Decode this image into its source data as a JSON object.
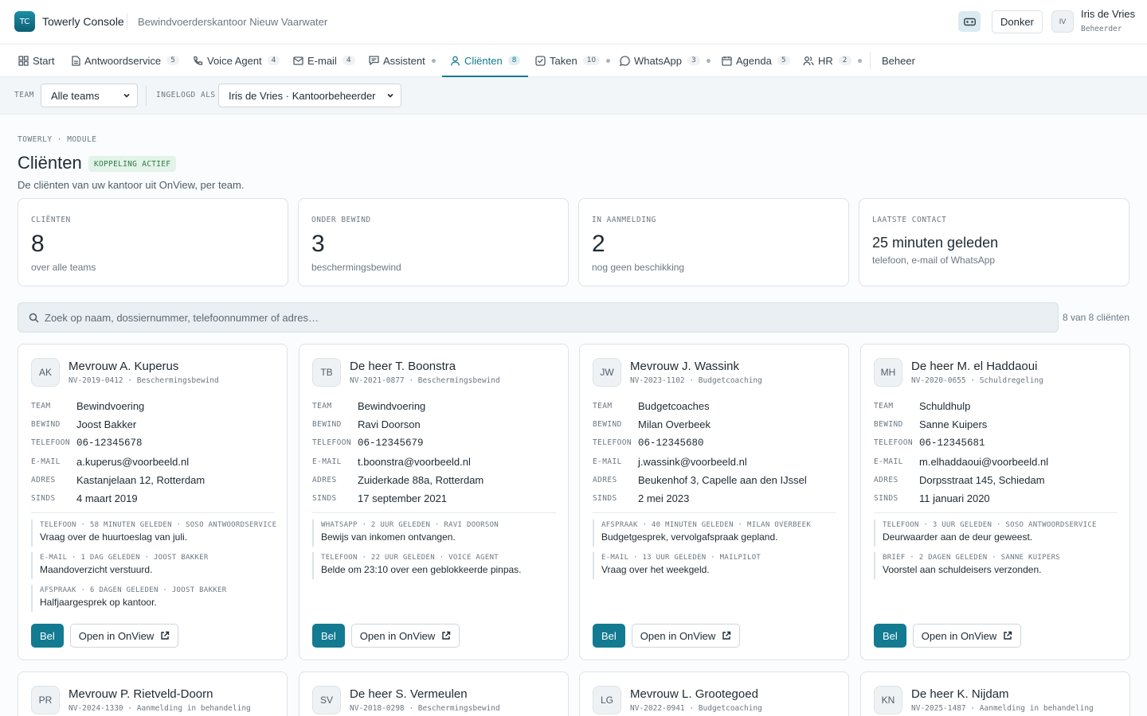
{
  "app": {
    "logo_initials": "TC",
    "name": "Towerly Console",
    "organization": "Bewindvoerderskantoor Nieuw Vaarwater",
    "theme_button": "Donker",
    "user": {
      "initials": "IV",
      "name": "Iris de Vries",
      "role": "Beheerder"
    }
  },
  "nav": [
    {
      "label": "Start",
      "icon": "grid-icon"
    },
    {
      "label": "Antwoordservice",
      "badge": "5",
      "icon": "document-icon"
    },
    {
      "label": "Voice Agent",
      "badge": "4",
      "icon": "phone-icon"
    },
    {
      "label": "E-mail",
      "badge": "4",
      "icon": "mail-icon"
    },
    {
      "label": "Assistent",
      "dot": true,
      "icon": "chat-icon"
    },
    {
      "label": "Cliënten",
      "badge": "8",
      "icon": "user-icon",
      "active": true
    },
    {
      "label": "Taken",
      "badge": "10",
      "dot": true,
      "icon": "checkbox-icon"
    },
    {
      "label": "WhatsApp",
      "badge": "3",
      "dot": true,
      "icon": "whatsapp-icon"
    },
    {
      "label": "Agenda",
      "badge": "5",
      "icon": "calendar-icon"
    },
    {
      "label": "HR",
      "badge": "2",
      "dot": true,
      "icon": "users-icon"
    },
    {
      "label": "Beheer"
    }
  ],
  "filters": {
    "team_label": "TEAM",
    "team_value": "Alle teams",
    "login_label": "INGELOGD ALS",
    "login_value": "Iris de Vries · Kantoorbeheerder"
  },
  "page": {
    "eyebrow": "TOWERLY · MODULE",
    "title": "Cliënten",
    "status": "KOPPELING ACTIEF",
    "subtitle": "De cliënten van uw kantoor uit OnView, per team."
  },
  "stats": [
    {
      "label": "CLIËNTEN",
      "value": "8",
      "note": "over alle teams"
    },
    {
      "label": "ONDER BEWIND",
      "value": "3",
      "note": "beschermingsbewind"
    },
    {
      "label": "IN AANMELDING",
      "value": "2",
      "note": "nog geen beschikking"
    },
    {
      "label": "LAATSTE CONTACT",
      "value": "25 minuten geleden",
      "note": "telefoon, e-mail of WhatsApp"
    }
  ],
  "search": {
    "placeholder": "Zoek op naam, dossiernummer, telefoonnummer of adres…",
    "count": "8 van 8 cliënten"
  },
  "field_labels": {
    "team": "TEAM",
    "bewind": "BEWIND",
    "telefoon": "TELEFOON",
    "email": "E-MAIL",
    "adres": "ADRES",
    "sinds": "SINDS"
  },
  "actions": {
    "call": "Bel",
    "open": "Open in OnView"
  },
  "clients": [
    {
      "initials": "AK",
      "name": "Mevrouw A. Kuperus",
      "meta": "NV-2019-0412 · Beschermingsbewind",
      "team": "Bewindvoering",
      "bewind": "Joost Bakker",
      "telefoon": "06-12345678",
      "email": "a.kuperus@voorbeeld.nl",
      "adres": "Kastanjelaan 12, Rotterdam",
      "sinds": "4 maart 2019",
      "events": [
        {
          "meta": "TELEFOON · 58 MINUTEN GELEDEN · SOSO ANTWOORDSERVICE",
          "text": "Vraag over de huurtoeslag van juli."
        },
        {
          "meta": "E-MAIL · 1 DAG GELEDEN · JOOST BAKKER",
          "text": "Maandoverzicht verstuurd."
        },
        {
          "meta": "AFSPRAAK · 6 DAGEN GELEDEN · JOOST BAKKER",
          "text": "Halfjaargesprek op kantoor."
        }
      ]
    },
    {
      "initials": "TB",
      "name": "De heer T. Boonstra",
      "meta": "NV-2021-0877 · Beschermingsbewind",
      "team": "Bewindvoering",
      "bewind": "Ravi Doorson",
      "telefoon": "06-12345679",
      "email": "t.boonstra@voorbeeld.nl",
      "adres": "Zuiderkade 88a, Rotterdam",
      "sinds": "17 september 2021",
      "events": [
        {
          "meta": "WHATSAPP · 2 UUR GELEDEN · RAVI DOORSON",
          "text": "Bewijs van inkomen ontvangen."
        },
        {
          "meta": "TELEFOON · 22 UUR GELEDEN · VOICE AGENT",
          "text": "Belde om 23:10 over een geblokkeerde pinpas."
        }
      ]
    },
    {
      "initials": "JW",
      "name": "Mevrouw J. Wassink",
      "meta": "NV-2023-1102 · Budgetcoaching",
      "team": "Budgetcoaches",
      "bewind": "Milan Overbeek",
      "telefoon": "06-12345680",
      "email": "j.wassink@voorbeeld.nl",
      "adres": "Beukenhof 3, Capelle aan den IJssel",
      "sinds": "2 mei 2023",
      "events": [
        {
          "meta": "AFSPRAAK · 40 MINUTEN GELEDEN · MILAN OVERBEEK",
          "text": "Budgetgesprek, vervolgafspraak gepland."
        },
        {
          "meta": "E-MAIL · 13 UUR GELEDEN · MAILPILOT",
          "text": "Vraag over het weekgeld."
        }
      ]
    },
    {
      "initials": "MH",
      "name": "De heer M. el Haddaoui",
      "meta": "NV-2020-0655 · Schuldregeling",
      "team": "Schuldhulp",
      "bewind": "Sanne Kuipers",
      "telefoon": "06-12345681",
      "email": "m.elhaddaoui@voorbeeld.nl",
      "adres": "Dorpsstraat 145, Schiedam",
      "sinds": "11 januari 2020",
      "events": [
        {
          "meta": "TELEFOON · 3 UUR GELEDEN · SOSO ANTWOORDSERVICE",
          "text": "Deurwaarder aan de deur geweest."
        },
        {
          "meta": "BRIEF · 2 DAGEN GELEDEN · SANNE KUIPERS",
          "text": "Voorstel aan schuldeisers verzonden."
        }
      ]
    },
    {
      "initials": "PR",
      "name": "Mevrouw P. Rietveld-Doorn",
      "meta": "NV-2024-1330 · Aanmelding in behandeling"
    },
    {
      "initials": "SV",
      "name": "De heer S. Vermeulen",
      "meta": "NV-2018-0298 · Beschermingsbewind"
    },
    {
      "initials": "LG",
      "name": "Mevrouw L. Grootegoed",
      "meta": "NV-2022-0941 · Budgetcoaching"
    },
    {
      "initials": "KN",
      "name": "De heer K. Nijdam",
      "meta": "NV-2025-1487 · Aanmelding in behandeling"
    }
  ],
  "colors": {
    "accent": "#127a91",
    "success_bg": "#e4f3e9",
    "success_text": "#2e7b48"
  }
}
